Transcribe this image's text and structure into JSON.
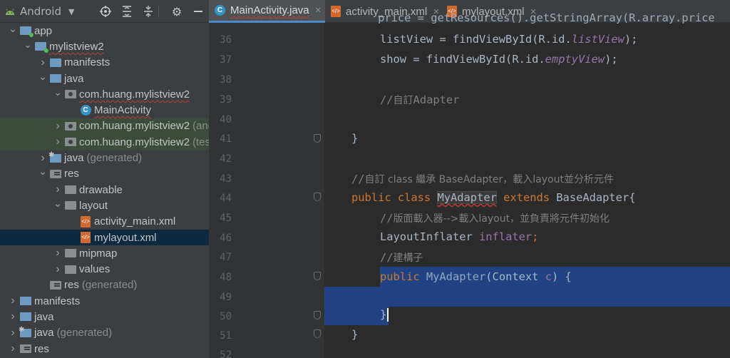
{
  "project_panel": {
    "view_selector": "Android",
    "tree": [
      {
        "label": "app",
        "indent": 0,
        "expanded": true,
        "icon": "module-folder-icon"
      },
      {
        "label": "mylistview2",
        "indent": 1,
        "expanded": true,
        "icon": "module-folder-icon",
        "wavy": true
      },
      {
        "label": "manifests",
        "indent": 2,
        "expanded": false,
        "icon": "folder-icon"
      },
      {
        "label": "java",
        "indent": 2,
        "expanded": true,
        "icon": "folder-icon"
      },
      {
        "label": "com.huang.mylistview2",
        "indent": 3,
        "expanded": true,
        "icon": "package-icon",
        "wavy": true
      },
      {
        "label": "MainActivity",
        "indent": 4,
        "icon": "class-icon",
        "wavy": true
      },
      {
        "label": "com.huang.mylistview2",
        "suffix": "(andro",
        "indent": 3,
        "expanded": false,
        "icon": "package-icon",
        "tinted": true
      },
      {
        "label": "com.huang.mylistview2",
        "suffix": "(test)",
        "indent": 3,
        "expanded": false,
        "icon": "package-icon",
        "tinted": true
      },
      {
        "label": "java",
        "suffix": "(generated)",
        "indent": 2,
        "expanded": false,
        "icon": "generated-folder-icon"
      },
      {
        "label": "res",
        "indent": 2,
        "expanded": true,
        "icon": "res-folder-icon"
      },
      {
        "label": "drawable",
        "indent": 3,
        "expanded": false,
        "icon": "folder-grey-icon"
      },
      {
        "label": "layout",
        "indent": 3,
        "expanded": true,
        "icon": "folder-grey-icon"
      },
      {
        "label": "activity_main.xml",
        "indent": 4,
        "icon": "xml-file-icon"
      },
      {
        "label": "mylayout.xml",
        "indent": 4,
        "icon": "xml-file-icon",
        "selected": true
      },
      {
        "label": "mipmap",
        "indent": 3,
        "expanded": false,
        "icon": "folder-grey-icon"
      },
      {
        "label": "values",
        "indent": 3,
        "expanded": false,
        "icon": "folder-grey-icon"
      },
      {
        "label": "res",
        "suffix": "(generated)",
        "indent": 2,
        "icon": "res-folder-icon"
      },
      {
        "label": "manifests",
        "indent": 0,
        "expanded": false,
        "icon": "folder-icon"
      },
      {
        "label": "java",
        "indent": 0,
        "expanded": false,
        "icon": "folder-icon"
      },
      {
        "label": "java",
        "suffix": "(generated)",
        "indent": 0,
        "expanded": false,
        "icon": "generated-folder-icon"
      },
      {
        "label": "res",
        "indent": 0,
        "expanded": false,
        "icon": "res-folder-icon"
      }
    ]
  },
  "tabs": [
    {
      "label": "MainActivity.java",
      "active": true,
      "icon": "class-icon",
      "wavy": true
    },
    {
      "label": "activity_main.xml",
      "active": false,
      "icon": "xml-file-icon"
    },
    {
      "label": "mylayout.xml",
      "active": false,
      "icon": "xml-file-icon"
    }
  ],
  "editor": {
    "line_numbers": [
      "36",
      "37",
      "38",
      "39",
      "40",
      "41",
      "42",
      "43",
      "44",
      "45",
      "46",
      "47",
      "48",
      "49",
      "50",
      "51",
      "52"
    ],
    "top_partial_line": "    price = getResources().getStringArray(R.array.price",
    "lines": {
      "l36": {
        "a": "listView = findViewById(R.id.",
        "b": "listView",
        "c": ");"
      },
      "l37": {
        "a": "show = findViewById(R.id.",
        "b": "emptyView",
        "c": ");"
      },
      "l39": {
        "a": "//",
        "b": "自訂",
        "c": "Adapter"
      },
      "l41": {
        "a": "}"
      },
      "l43": {
        "a": "//",
        "b": "自訂 class 繼承 BaseAdapter，載入layout並分析元件"
      },
      "l44": {
        "kw1": "public class ",
        "name": "MyAdapter",
        "kw2": " extends ",
        "base": "BaseAdapter{"
      },
      "l45": {
        "a": "//",
        "b": "版面載入器-->載入layout，並負責將元件初始化"
      },
      "l46": {
        "type": "LayoutInflater ",
        "field": "inflater",
        "semi": ";"
      },
      "l47": {
        "a": "//",
        "b": "建構子"
      },
      "l48": {
        "kw": "public ",
        "name": "MyAdapter",
        "a": "(Context ",
        "param": "c",
        "b": ") {"
      },
      "l50": {
        "a": "}"
      },
      "l51": {
        "a": "}"
      }
    },
    "colors": {
      "keyword": "#cc7832",
      "comment": "#808080",
      "field": "#9876aa",
      "selection": "#214283"
    }
  }
}
